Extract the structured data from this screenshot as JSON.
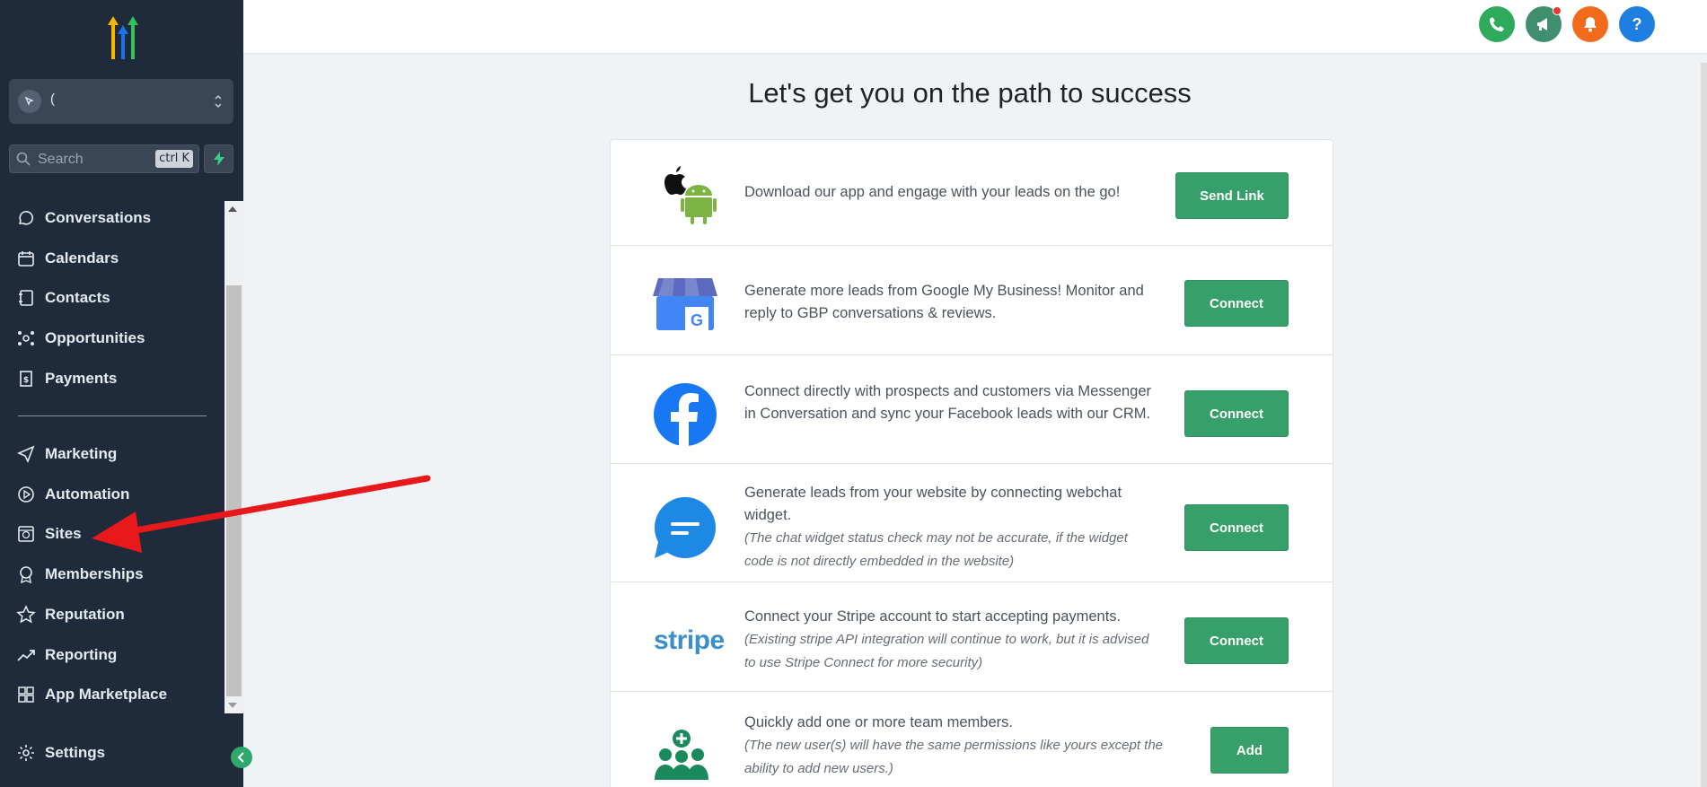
{
  "sidebar": {
    "account_name": "(",
    "search_placeholder": "Search",
    "search_shortcut": "ctrl K",
    "items": [
      {
        "label": "Conversations",
        "icon": "chat-bubble-icon"
      },
      {
        "label": "Calendars",
        "icon": "calendar-icon"
      },
      {
        "label": "Contacts",
        "icon": "contacts-book-icon"
      },
      {
        "label": "Opportunities",
        "icon": "opportunities-network-icon"
      },
      {
        "label": "Payments",
        "icon": "payments-receipt-icon"
      },
      {
        "label": "Marketing",
        "icon": "send-plane-icon"
      },
      {
        "label": "Automation",
        "icon": "automation-play-icon"
      },
      {
        "label": "Sites",
        "icon": "sites-globe-icon"
      },
      {
        "label": "Memberships",
        "icon": "badge-icon"
      },
      {
        "label": "Reputation",
        "icon": "star-icon"
      },
      {
        "label": "Reporting",
        "icon": "trend-up-icon"
      },
      {
        "label": "App Marketplace",
        "icon": "apps-grid-icon"
      }
    ],
    "settings_label": "Settings"
  },
  "topbar": {
    "buttons": [
      {
        "name": "phone-icon",
        "color": "#2eaa5c"
      },
      {
        "name": "megaphone-icon",
        "color": "#3f8f6f"
      },
      {
        "name": "bell-icon",
        "color": "#f26b1d"
      },
      {
        "name": "help-icon",
        "color": "#1f7fe0"
      }
    ]
  },
  "main": {
    "title": "Let's get you on the path to success",
    "rows": [
      {
        "text": "Download our app and engage with your leads on the go!",
        "note": "",
        "button": "Send Link"
      },
      {
        "text": "Generate more leads from Google My Business! Monitor and reply to GBP conversations & reviews.",
        "note": "",
        "button": "Connect"
      },
      {
        "text": "Connect directly with prospects and customers via Messenger in Conversation and sync your Facebook leads with our CRM.",
        "note": "",
        "button": "Connect"
      },
      {
        "text": "Generate leads from your website by connecting webchat widget.",
        "note": "(The chat widget status check may not be accurate, if the widget code is not directly embedded in the website)",
        "button": "Connect"
      },
      {
        "text": "Connect your Stripe account to start accepting payments.",
        "note": "(Existing stripe API integration will continue to work, but it is advised to use Stripe Connect for more security)",
        "button": "Connect",
        "logo_text": "stripe"
      },
      {
        "text": "Quickly add one or more team members.",
        "note": "(The new user(s) will have the same permissions like yours except the ability to add new users.)",
        "button": "Add"
      }
    ]
  },
  "colors": {
    "sidebar_bg": "#1f2b3b",
    "button_green": "#37a06a",
    "annotation_arrow": "#e8191b"
  }
}
